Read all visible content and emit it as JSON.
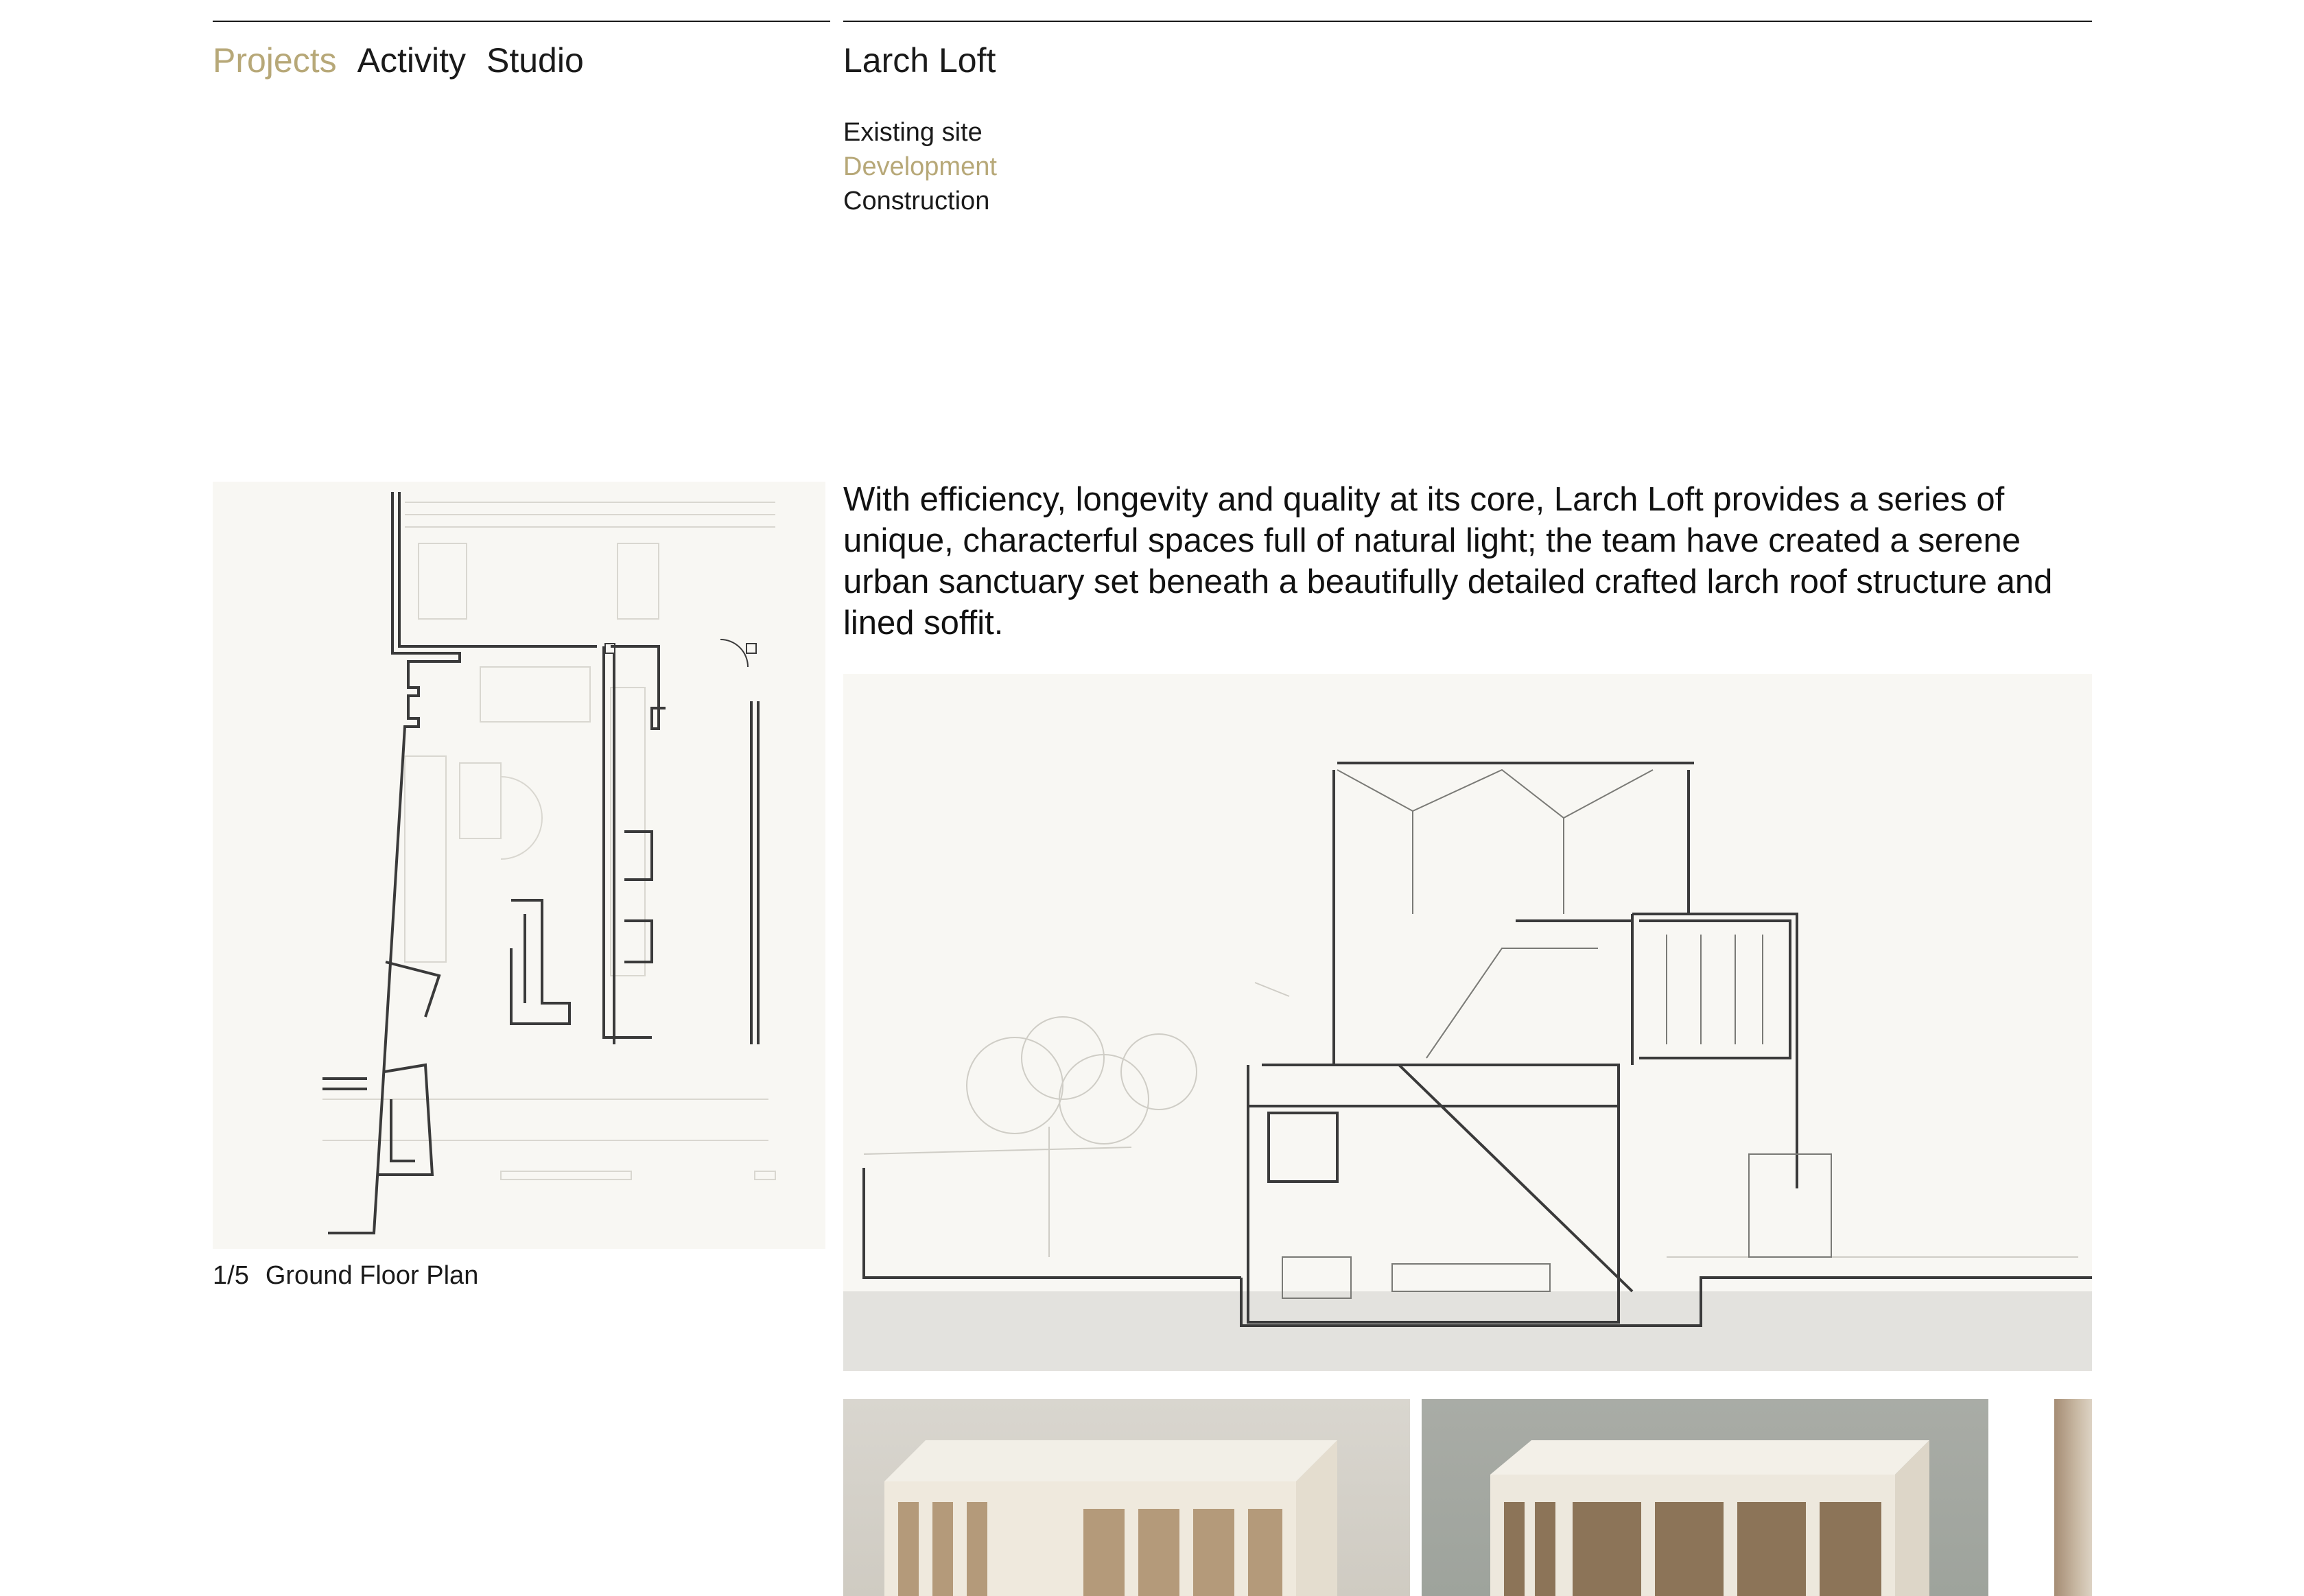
{
  "nav": {
    "items": [
      {
        "label": "Projects",
        "active": true
      },
      {
        "label": "Activity",
        "active": false
      },
      {
        "label": "Studio",
        "active": false
      }
    ]
  },
  "project": {
    "title": "Larch Loft",
    "phases": [
      {
        "label": "Existing site",
        "active": false
      },
      {
        "label": "Development",
        "active": true
      },
      {
        "label": "Construction",
        "active": false
      }
    ],
    "description": "With efficiency, longevity and quality at its core, Larch Loft provides a series of unique, characterful spaces full of natural light; the team have created a serene urban sanctuary set beneath a beautifully detailed crafted larch roof structure and lined soffit."
  },
  "gallery": {
    "counter": "1/5",
    "caption": "Ground Floor Plan"
  },
  "colors": {
    "accent": "#b7a878",
    "text": "#1a1a1a",
    "drawing_background": "#f8f7f3"
  }
}
